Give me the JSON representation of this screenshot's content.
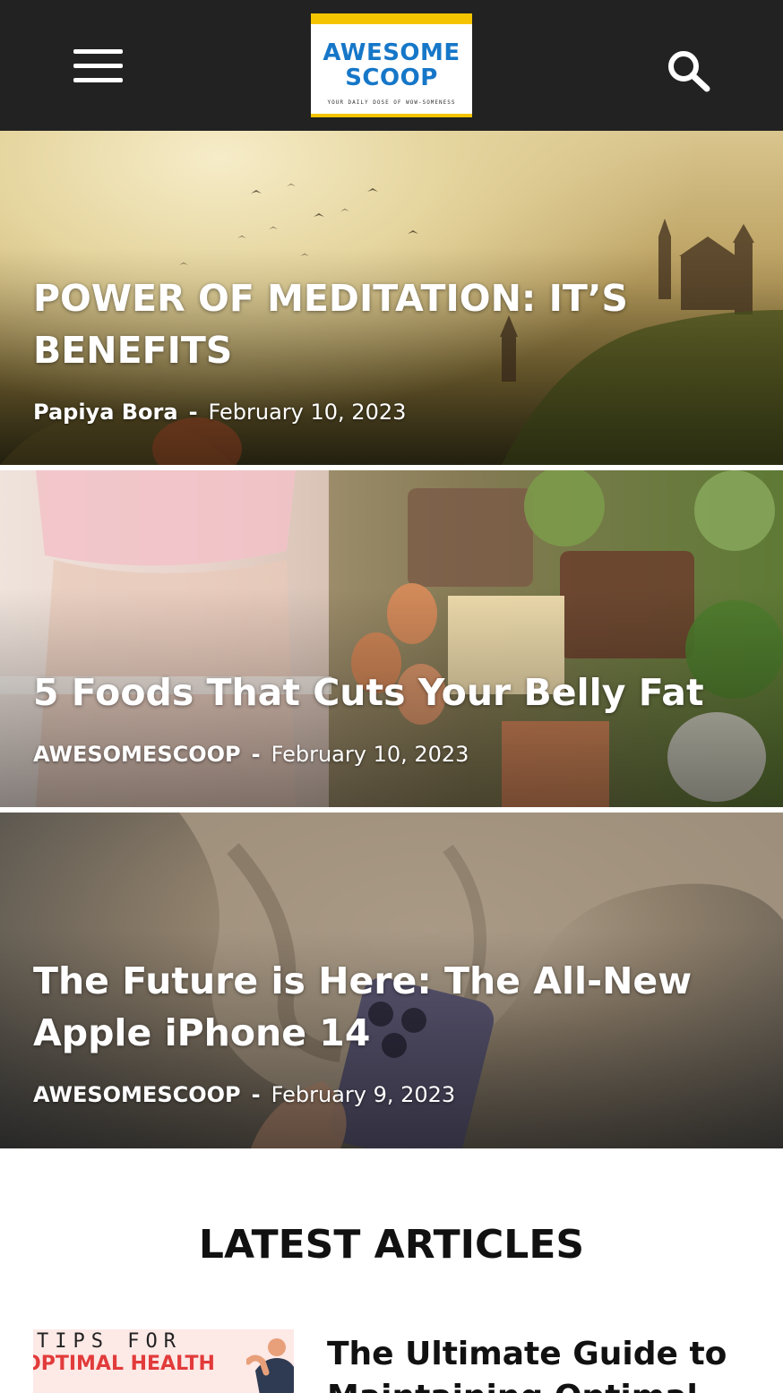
{
  "header": {
    "menu_icon": "hamburger-menu-icon",
    "search_icon": "search-icon",
    "logo": {
      "line1": "AWESOME",
      "line2": "SCOOP",
      "tagline": "YOUR DAILY DOSE OF WOW-SOMENESS",
      "colors": {
        "text": "#1677c8",
        "bar": "#f5c400"
      }
    },
    "background": "#222222"
  },
  "hero_posts": [
    {
      "title": "POWER OF MEDITATION: IT’S BENEFITS",
      "author": "Papiya Bora",
      "separator": "-",
      "date": "February 10, 2023"
    },
    {
      "title": "5 Foods That Cuts Your Belly Fat",
      "author": "AWESOMESCOOP",
      "separator": "-",
      "date": "February 10, 2023"
    },
    {
      "title": "The Future is Here: The All-New Apple iPhone 14",
      "author": "AWESOMESCOOP",
      "separator": "-",
      "date": "February 9, 2023"
    }
  ],
  "latest": {
    "heading": "LATEST ARTICLES",
    "articles": [
      {
        "thumb_line1": "TIPS FOR",
        "thumb_line2": "OPTIMAL HEALTH",
        "title": "The Ultimate Guide to Maintaining Optimal"
      }
    ]
  }
}
